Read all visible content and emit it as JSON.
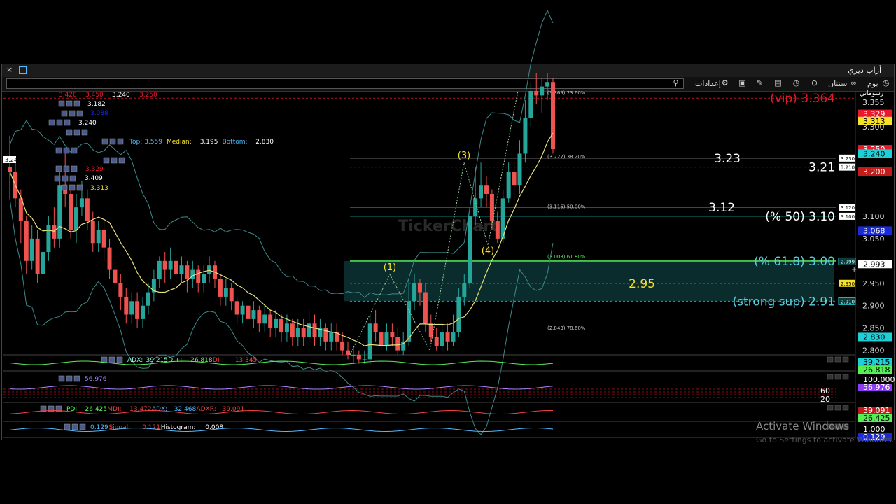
{
  "window": {
    "title": "أراب ديري",
    "close_glyph": "×",
    "toolbar": {
      "day_label": "يوم",
      "period_label": "سنتان",
      "settings_label": "إعدادات",
      "symbol_label": "رسوماتي"
    }
  },
  "os_watermark": {
    "line1": "Activate Windows",
    "line2": "Go to Settings to activate Windows."
  },
  "chart_data": {
    "type": "candlestick",
    "y_axis": {
      "ticks": [
        "3.355",
        "3.300",
        "3.100",
        "3.050",
        "2.950",
        "2.900",
        "2.850",
        "2.800"
      ],
      "ylim": [
        2.79,
        3.38
      ]
    },
    "price_badges": [
      {
        "text": "3.329",
        "bg": "#e8192c",
        "fg": "#ffffff",
        "value": 3.329
      },
      {
        "text": "3.313",
        "bg": "#f5e12a",
        "fg": "#000000",
        "value": 3.313
      },
      {
        "text": "3.250",
        "bg": "#e8192c",
        "fg": "#ffffff",
        "value": 3.25
      },
      {
        "text": "3.240",
        "bg": "#1ecfd6",
        "fg": "#000000",
        "value": 3.24
      },
      {
        "text": "3.200",
        "bg": "#c41a1a",
        "fg": "#ffffff",
        "value": 3.2
      },
      {
        "text": "3.068",
        "bg": "#1a2bd6",
        "fg": "#ffffff",
        "value": 3.068
      },
      {
        "text": "2.993",
        "bg": "#ffffff",
        "fg": "#000000",
        "value": 2.993
      },
      {
        "text": "2.830",
        "bg": "#1ecfd6",
        "fg": "#000000",
        "value": 2.83
      }
    ],
    "small_tags": [
      {
        "text": "3.230",
        "value": 3.23
      },
      {
        "text": "3.210",
        "value": 3.21
      },
      {
        "text": "3.120",
        "value": 3.12
      },
      {
        "text": "3.100",
        "value": 3.1
      },
      {
        "text": "2.999",
        "value": 2.999
      },
      {
        "text": "2.950",
        "value": 2.95
      },
      {
        "text": "2.910",
        "value": 2.91
      }
    ],
    "levels": [
      {
        "value": 3.364,
        "text": "(vip) 3.364",
        "color": "#e8192c"
      },
      {
        "value": 3.23,
        "text": "3.23",
        "color": "#ffffff"
      },
      {
        "value": 3.21,
        "text": "3.21",
        "color": "#ffffff"
      },
      {
        "value": 3.12,
        "text": "3.12",
        "color": "#ffffff"
      },
      {
        "value": 3.1,
        "text": "(% 50) 3.10",
        "color": "#ffffff"
      },
      {
        "value": 3.0,
        "text": "(% 61.8) 3.00",
        "color": "#5ad0e0"
      },
      {
        "value": 2.95,
        "text": "2.95",
        "color": "#f5e12a"
      },
      {
        "value": 2.91,
        "text": "(strong sup) 2.91",
        "color": "#5ad0e0"
      }
    ],
    "fib_labels": [
      {
        "value": 3.369,
        "text": "(3.369) 23.60%"
      },
      {
        "value": 3.227,
        "text": "(3.227) 38.20%"
      },
      {
        "value": 3.115,
        "text": "(3.115) 50.00%"
      },
      {
        "value": 3.003,
        "text": "(3.003) 61.80%"
      },
      {
        "value": 2.843,
        "text": "(2.843) 78.60%"
      }
    ],
    "waves": [
      {
        "text": "(1)",
        "value": 2.97
      },
      {
        "text": "(3)",
        "value": 3.22
      },
      {
        "text": "(4)",
        "value": 3.035
      }
    ],
    "candles": [
      [
        3.21,
        3.2,
        3.28,
        3.14
      ],
      [
        3.2,
        3.14,
        3.22,
        3.12
      ],
      [
        3.14,
        3.09,
        3.16,
        3.04
      ],
      [
        3.09,
        3.0,
        3.1,
        2.97
      ],
      [
        3.0,
        3.05,
        3.08,
        2.98
      ],
      [
        3.05,
        2.97,
        3.07,
        2.95
      ],
      [
        2.97,
        3.02,
        3.04,
        2.96
      ],
      [
        3.02,
        3.08,
        3.1,
        3.0
      ],
      [
        3.08,
        3.05,
        3.12,
        3.03
      ],
      [
        3.05,
        3.17,
        3.2,
        3.03
      ],
      [
        3.17,
        3.15,
        3.24,
        3.12
      ],
      [
        3.15,
        3.07,
        3.17,
        3.05
      ],
      [
        3.07,
        3.12,
        3.15,
        3.04
      ],
      [
        3.12,
        3.14,
        3.18,
        3.1
      ],
      [
        3.14,
        3.09,
        3.16,
        3.07
      ],
      [
        3.09,
        3.04,
        3.11,
        3.02
      ],
      [
        3.04,
        3.07,
        3.09,
        3.02
      ],
      [
        3.07,
        3.03,
        3.09,
        3.0
      ],
      [
        3.03,
        2.98,
        3.05,
        2.96
      ],
      [
        2.98,
        2.95,
        3.0,
        2.92
      ],
      [
        2.95,
        2.92,
        2.97,
        2.89
      ],
      [
        2.92,
        2.88,
        2.94,
        2.86
      ],
      [
        2.88,
        2.91,
        2.93,
        2.86
      ],
      [
        2.91,
        2.87,
        2.93,
        2.85
      ],
      [
        2.87,
        2.9,
        2.92,
        2.85
      ],
      [
        2.9,
        2.93,
        2.95,
        2.88
      ],
      [
        2.93,
        2.96,
        2.98,
        2.91
      ],
      [
        2.96,
        3.0,
        3.01,
        2.94
      ],
      [
        3.0,
        2.98,
        3.02,
        2.95
      ],
      [
        2.98,
        3.0,
        3.03,
        2.96
      ],
      [
        3.0,
        2.97,
        3.01,
        2.95
      ],
      [
        2.97,
        2.99,
        3.01,
        2.95
      ],
      [
        2.99,
        2.96,
        3.0,
        2.93
      ],
      [
        2.96,
        2.98,
        3.0,
        2.94
      ],
      [
        2.98,
        2.95,
        2.99,
        2.93
      ],
      [
        2.95,
        2.97,
        2.99,
        2.93
      ],
      [
        2.97,
        2.99,
        3.01,
        2.95
      ],
      [
        2.99,
        2.96,
        3.0,
        2.94
      ],
      [
        2.96,
        2.92,
        2.97,
        2.9
      ],
      [
        2.92,
        2.94,
        2.96,
        2.9
      ],
      [
        2.94,
        2.91,
        2.95,
        2.89
      ],
      [
        2.91,
        2.88,
        2.92,
        2.86
      ],
      [
        2.88,
        2.9,
        2.91,
        2.86
      ],
      [
        2.9,
        2.87,
        2.91,
        2.85
      ],
      [
        2.87,
        2.89,
        2.91,
        2.85
      ],
      [
        2.89,
        2.86,
        2.9,
        2.84
      ],
      [
        2.86,
        2.88,
        2.9,
        2.84
      ],
      [
        2.88,
        2.85,
        2.89,
        2.83
      ],
      [
        2.85,
        2.87,
        2.89,
        2.83
      ],
      [
        2.87,
        2.84,
        2.88,
        2.82
      ],
      [
        2.84,
        2.86,
        2.88,
        2.82
      ],
      [
        2.86,
        2.83,
        2.87,
        2.81
      ],
      [
        2.83,
        2.85,
        2.87,
        2.81
      ],
      [
        2.85,
        2.83,
        2.87,
        2.81
      ],
      [
        2.83,
        2.86,
        2.89,
        2.82
      ],
      [
        2.86,
        2.83,
        2.88,
        2.81
      ],
      [
        2.83,
        2.85,
        2.87,
        2.81
      ],
      [
        2.85,
        2.82,
        2.86,
        2.8
      ],
      [
        2.82,
        2.84,
        2.86,
        2.8
      ],
      [
        2.84,
        2.82,
        2.86,
        2.8
      ],
      [
        2.82,
        2.8,
        2.84,
        2.79
      ],
      [
        2.8,
        2.79,
        2.82,
        2.78
      ],
      [
        2.79,
        2.79,
        2.81,
        2.77
      ],
      [
        2.79,
        2.78,
        2.8,
        2.77
      ],
      [
        2.78,
        2.78,
        2.8,
        2.77
      ],
      [
        2.78,
        2.86,
        2.88,
        2.77
      ],
      [
        2.86,
        2.84,
        2.89,
        2.82
      ],
      [
        2.84,
        2.81,
        2.86,
        2.8
      ],
      [
        2.81,
        2.84,
        2.86,
        2.8
      ],
      [
        2.84,
        2.83,
        2.86,
        2.81
      ],
      [
        2.83,
        2.8,
        2.85,
        2.79
      ],
      [
        2.8,
        2.82,
        2.84,
        2.79
      ],
      [
        2.82,
        2.91,
        2.96,
        2.81
      ],
      [
        2.91,
        2.95,
        2.97,
        2.89
      ],
      [
        2.95,
        2.93,
        2.96,
        2.9
      ],
      [
        2.93,
        2.86,
        2.95,
        2.84
      ],
      [
        2.86,
        2.83,
        2.88,
        2.82
      ],
      [
        2.83,
        2.81,
        2.85,
        2.8
      ],
      [
        2.81,
        2.84,
        2.86,
        2.8
      ],
      [
        2.84,
        2.82,
        2.86,
        2.8
      ],
      [
        2.82,
        2.84,
        2.88,
        2.81
      ],
      [
        2.84,
        2.92,
        2.94,
        2.83
      ],
      [
        2.92,
        2.95,
        2.97,
        2.9
      ],
      [
        2.95,
        3.1,
        3.12,
        2.94
      ],
      [
        3.1,
        3.14,
        3.21,
        3.08
      ],
      [
        3.14,
        3.17,
        3.22,
        3.12
      ],
      [
        3.17,
        3.15,
        3.19,
        3.12
      ],
      [
        3.15,
        3.09,
        3.16,
        3.07
      ],
      [
        3.09,
        3.05,
        3.11,
        3.04
      ],
      [
        3.05,
        3.14,
        3.16,
        3.04
      ],
      [
        3.14,
        3.2,
        3.22,
        3.13
      ],
      [
        3.2,
        3.17,
        3.22,
        3.13
      ],
      [
        3.17,
        3.24,
        3.27,
        3.15
      ],
      [
        3.24,
        3.32,
        3.36,
        3.22
      ],
      [
        3.32,
        3.38,
        3.4,
        3.3
      ],
      [
        3.38,
        3.37,
        3.42,
        3.35
      ],
      [
        3.37,
        3.39,
        3.41,
        3.33
      ],
      [
        3.39,
        3.4,
        3.42,
        3.36
      ],
      [
        3.4,
        3.25,
        3.41,
        3.24
      ]
    ],
    "indicators": {
      "bb_info": {
        "top_label": "Top:",
        "top": "3.559",
        "median_label": "Median:",
        "median": "3.195",
        "bottom_label": "Bottom:",
        "bottom": "2.830"
      },
      "left_values": [
        "3.420",
        "3.450",
        "3.240",
        "3.250",
        "3.182",
        "3.088",
        "3.240",
        "3.329",
        "3.409",
        "3.313"
      ],
      "left_value_colors": [
        "#e8192c",
        "#e8192c",
        "#ffffff",
        "#e8192c",
        "#ffffff",
        "#1a2bd6",
        "#ffffff",
        "#e8192c",
        "#ffffff",
        "#f5e12a"
      ],
      "left_marker": "3.24",
      "panels": [
        {
          "name": "adx",
          "legend": [
            [
              "ADX: ",
              "#9fd"
            ],
            [
              "39.215",
              "#9fd"
            ],
            [
              " DI+: ",
              "#5f5"
            ],
            [
              "26.818",
              "#5f5"
            ],
            [
              " DI-: ",
              "#e44"
            ],
            [
              "13.345",
              "#e44"
            ]
          ],
          "badges": [
            [
              "39.215",
              "#1ecfd6",
              "#000"
            ],
            [
              "26.818",
              "#5e5",
              "#000"
            ]
          ]
        },
        {
          "name": "rsi",
          "legend": [
            [
              "56.976",
              "#a8f"
            ]
          ],
          "badges": [
            [
              "100.000",
              "#000",
              "#fff"
            ],
            [
              "56.976",
              "#8a3cf0",
              "#fff"
            ]
          ],
          "levels": [
            "80",
            "60",
            "40",
            "20"
          ]
        },
        {
          "name": "dmi",
          "legend": [
            [
              "PDI: ",
              "#5f5"
            ],
            [
              "26.425",
              "#5f5"
            ],
            [
              " MDI: ",
              "#e44"
            ],
            [
              "13.472",
              "#e44"
            ],
            [
              " ADX: ",
              "#5bf"
            ],
            [
              "32.468",
              "#5bf"
            ],
            [
              " ADXR: ",
              "#e44"
            ],
            [
              "39.091",
              "#e44"
            ]
          ],
          "badges": [
            [
              "39.091",
              "#c41a1a",
              "#fff"
            ],
            [
              "26.425",
              "#5e5",
              "#000"
            ]
          ]
        },
        {
          "name": "macd",
          "legend": [
            [
              "0.129",
              "#5bf"
            ],
            [
              " Signal: ",
              "#e44"
            ],
            [
              "0.121",
              "#e44"
            ],
            [
              " Histogram: ",
              "#fff"
            ],
            [
              "0.008",
              "#fff"
            ]
          ],
          "badges": [
            [
              "1.000",
              "#000",
              "#fff"
            ],
            [
              "0.129",
              "#1a2bd6",
              "#fff"
            ]
          ]
        }
      ]
    },
    "watermark_text": "TickerChart"
  }
}
